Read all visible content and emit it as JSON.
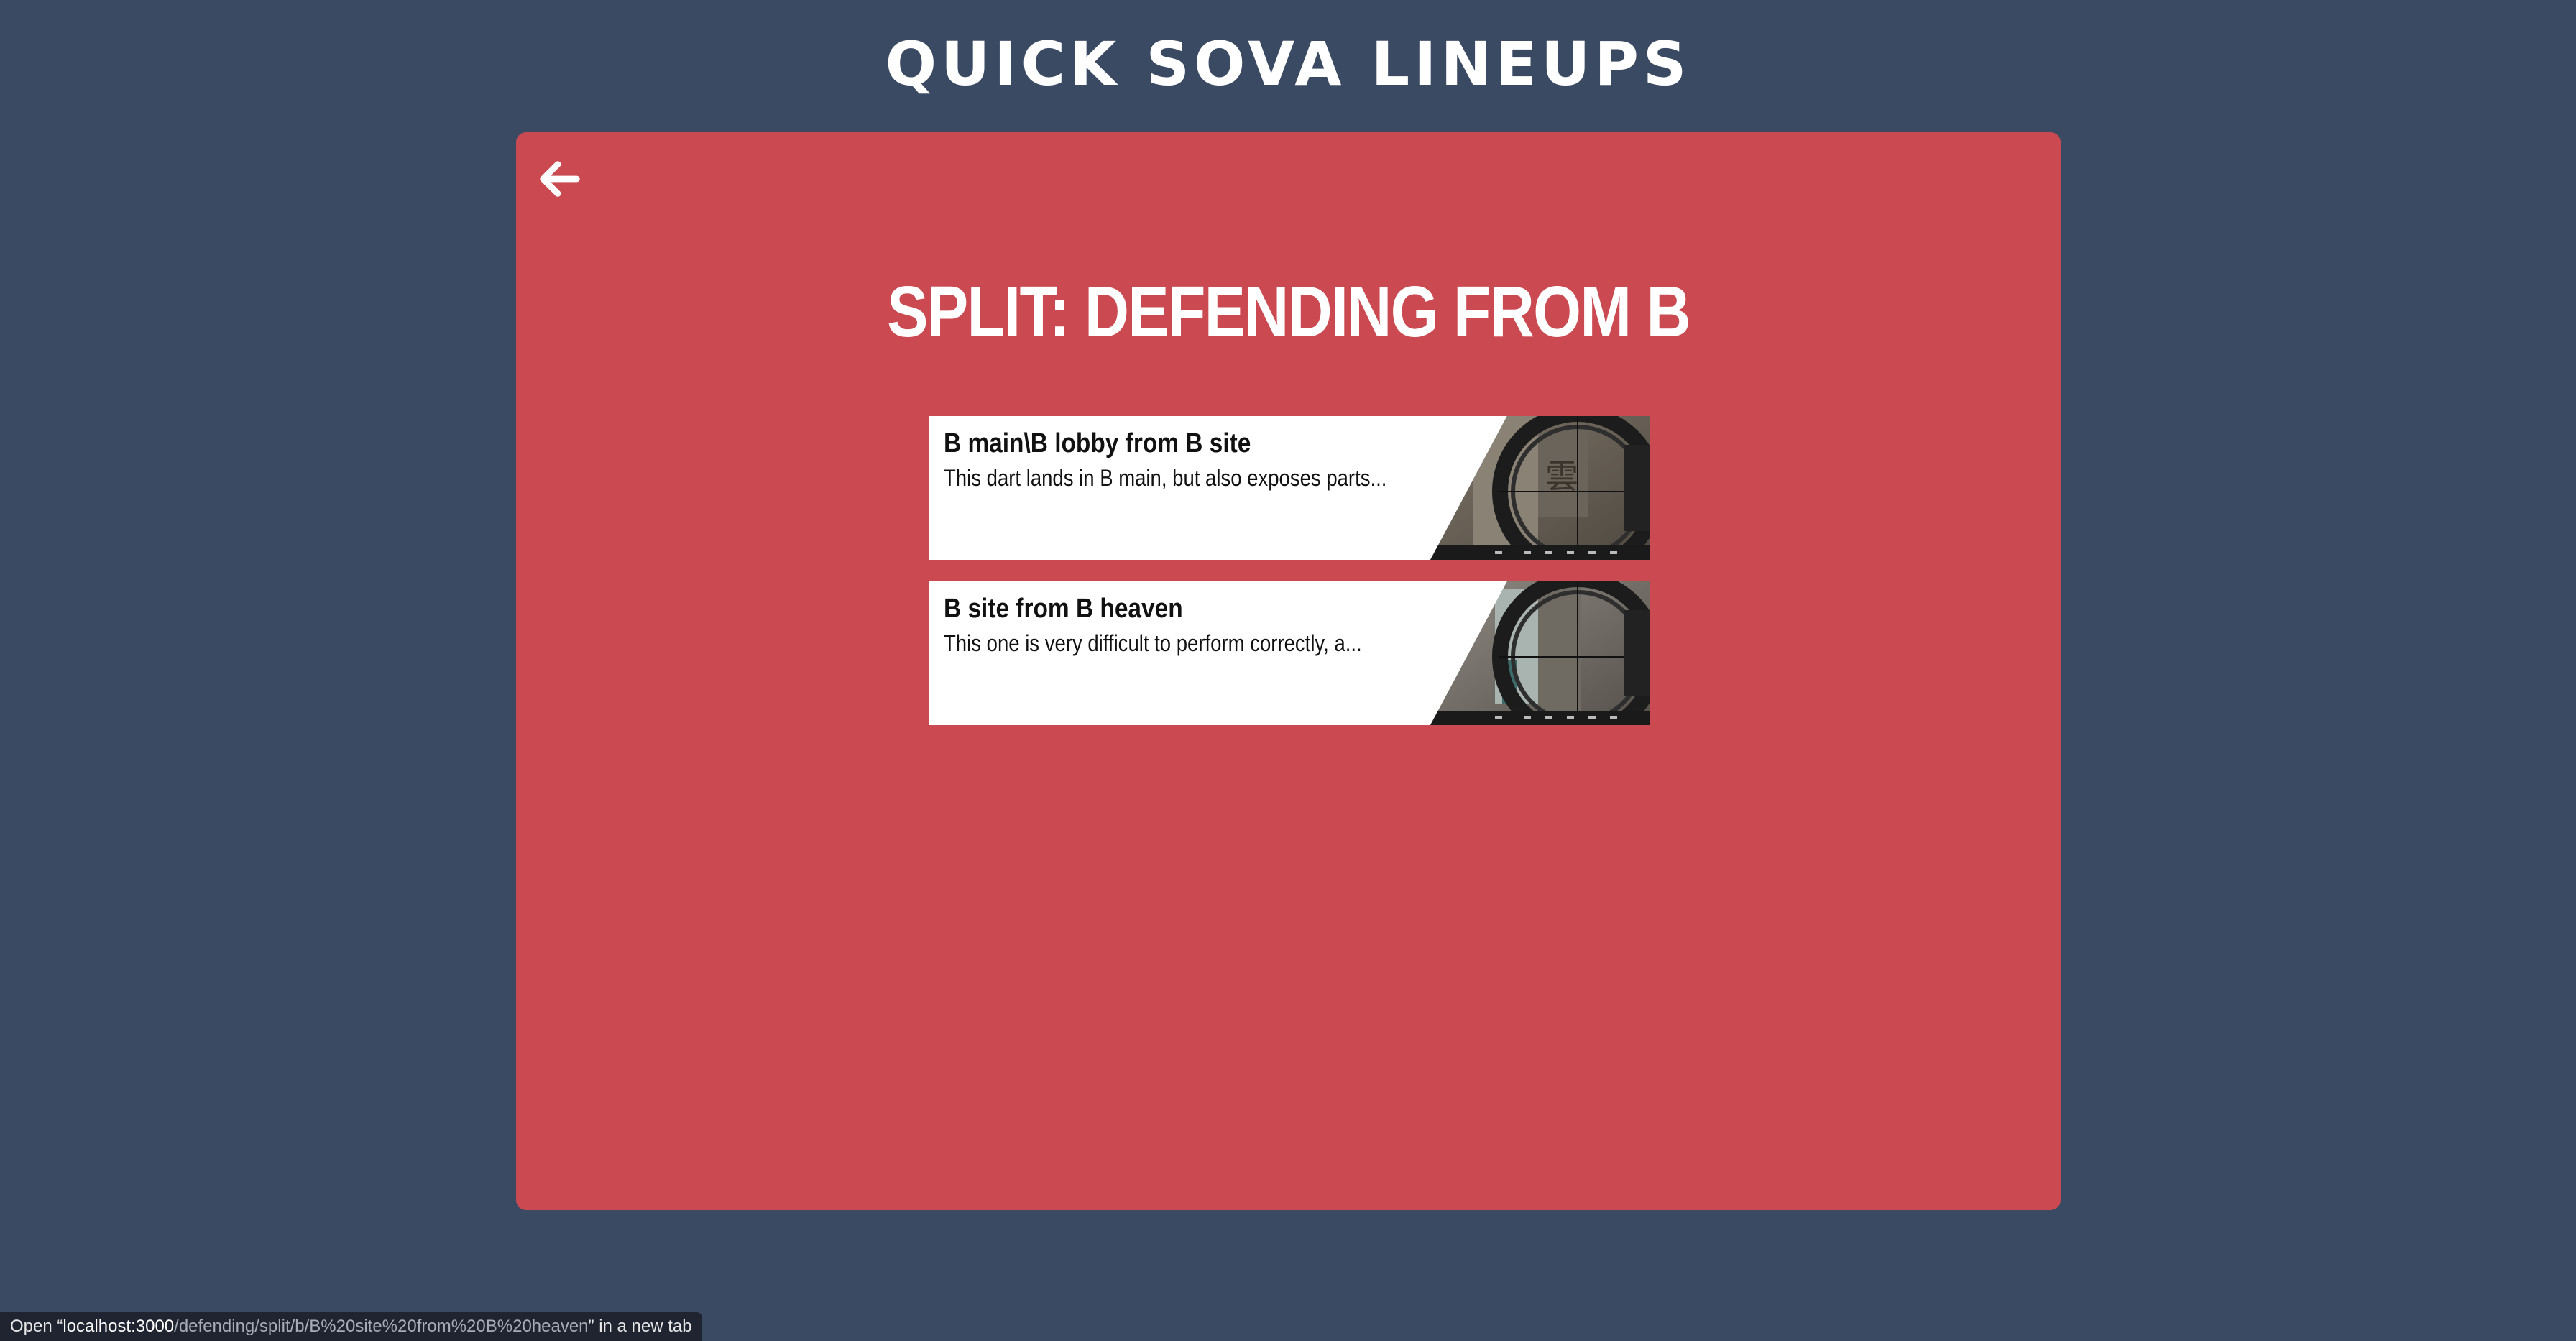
{
  "app": {
    "logo_text": "QUICK SOVA LINEUPS"
  },
  "page": {
    "title": "SPLIT: DEFENDING FROM B",
    "back_label": "Back"
  },
  "lineups": [
    {
      "title": "B main\\B lobby from B site",
      "description": "This dart lands in B main, but also exposes parts..."
    },
    {
      "title": "B site from B heaven",
      "description": "This one is very difficult to perform correctly, a..."
    }
  ],
  "status_bar": {
    "prefix": "Open “",
    "host": "localhost:3000",
    "path": "/defending/split/b/B%20site%20from%20B%20heaven",
    "suffix": "” in a new tab"
  },
  "colors": {
    "background": "#3a4a63",
    "panel": "#cb4a51",
    "card": "#ffffff",
    "text_light": "#ffffff",
    "text_dark": "#111111"
  },
  "icons": {
    "back": "arrow-left-icon"
  }
}
